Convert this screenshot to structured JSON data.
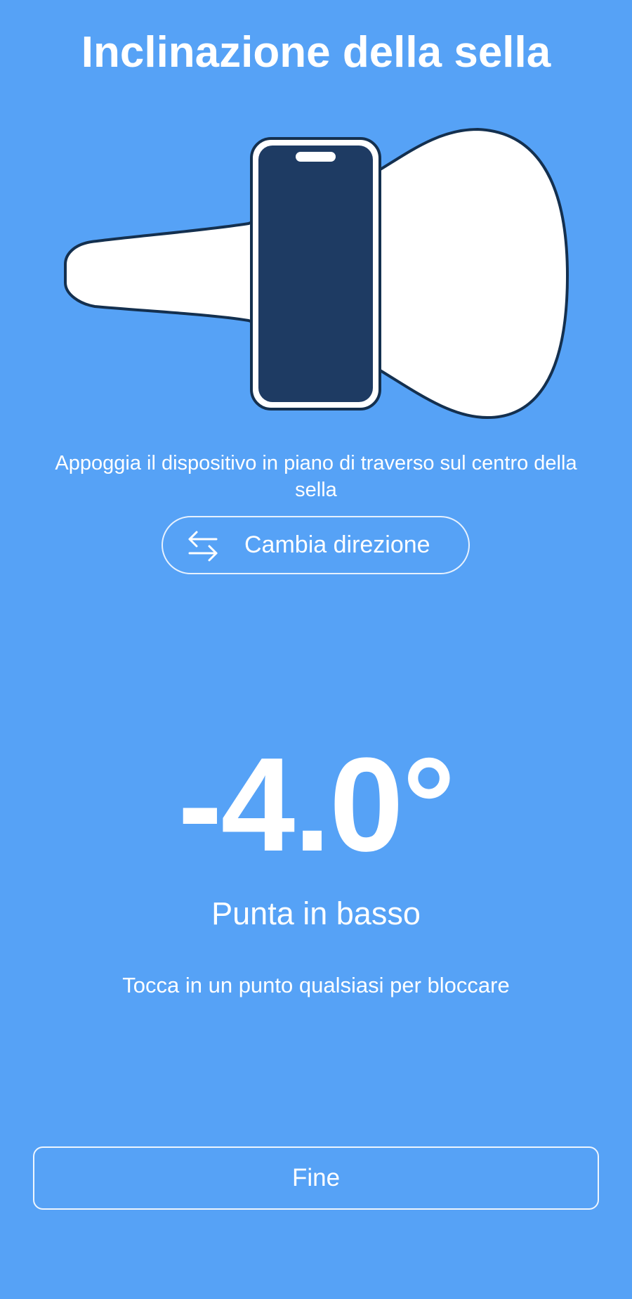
{
  "screen": {
    "title": "Inclinazione della sella",
    "illustration_icon": "phone-on-saddle-illustration",
    "instruction": "Appoggia il dispositivo in piano di traverso sul centro della sella",
    "switch_direction": {
      "label": "Cambia direzione",
      "icon": "swap-arrows-icon"
    },
    "angle": "-4.0°",
    "direction_label": "Punta in basso",
    "hint": "Tocca in un punto qualsiasi per bloccare",
    "done_label": "Fine"
  },
  "colors": {
    "background": "#56a2f6",
    "text": "#ffffff",
    "phone_screen": "#1e3b63",
    "saddle_fill": "#ffffff",
    "outline": "#14304f"
  }
}
